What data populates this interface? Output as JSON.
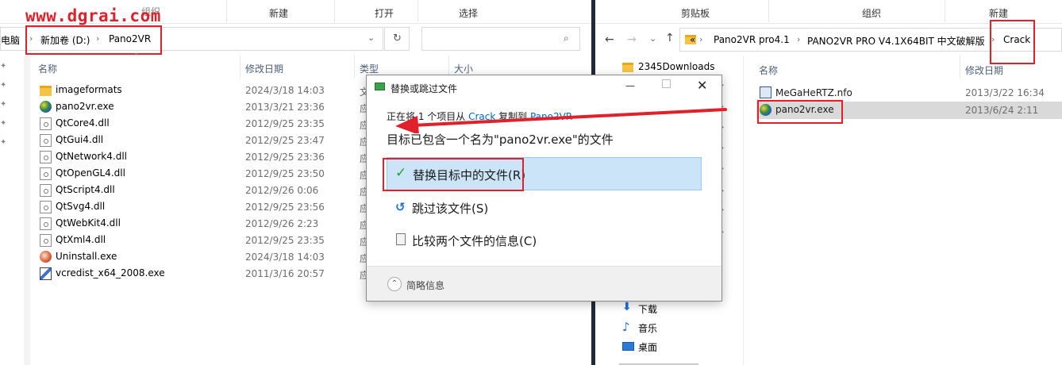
{
  "watermark": "www.dgrai.com",
  "left_window": {
    "ribbon": [
      "组织",
      "新建",
      "打开",
      "选择"
    ],
    "breadcrumb": {
      "truncated": "电脑",
      "drive": "新加卷 (D:)",
      "folder": "Pano2VR"
    },
    "columns": {
      "name": "名称",
      "date": "修改日期",
      "type": "类型",
      "size": "大小"
    },
    "files": [
      {
        "name": "imageformats",
        "date": "2024/3/18 14:03",
        "type": "文",
        "icon": "folder-icon"
      },
      {
        "name": "pano2vr.exe",
        "date": "2013/3/21 23:36",
        "type": "应",
        "icon": "pano2vr-app-icon"
      },
      {
        "name": "QtCore4.dll",
        "date": "2012/9/25 23:35",
        "type": "应",
        "icon": "dll-file-icon"
      },
      {
        "name": "QtGui4.dll",
        "date": "2012/9/25 23:47",
        "type": "应",
        "icon": "dll-file-icon"
      },
      {
        "name": "QtNetwork4.dll",
        "date": "2012/9/25 23:36",
        "type": "应",
        "icon": "dll-file-icon"
      },
      {
        "name": "QtOpenGL4.dll",
        "date": "2012/9/25 23:50",
        "type": "应",
        "icon": "dll-file-icon"
      },
      {
        "name": "QtScript4.dll",
        "date": "2012/9/26 0:06",
        "type": "应",
        "icon": "dll-file-icon"
      },
      {
        "name": "QtSvg4.dll",
        "date": "2012/9/25 23:56",
        "type": "应",
        "icon": "dll-file-icon"
      },
      {
        "name": "QtWebKit4.dll",
        "date": "2012/9/26 2:23",
        "type": "应",
        "icon": "dll-file-icon"
      },
      {
        "name": "QtXml4.dll",
        "date": "2012/9/25 23:35",
        "type": "应",
        "icon": "dll-file-icon"
      },
      {
        "name": "Uninstall.exe",
        "date": "2024/3/18 14:03",
        "type": "应",
        "icon": "uninstall-icon"
      },
      {
        "name": "vcredist_x64_2008.exe",
        "date": "2011/3/16 20:57",
        "type": "应",
        "icon": "installer-icon"
      }
    ]
  },
  "right_window": {
    "ribbon": [
      "剪贴板",
      "组织",
      "新建"
    ],
    "breadcrumb": {
      "overflow": "«",
      "items": [
        "Pano2VR pro4.1",
        "PANO2VR PRO V4.1X64BIT 中文破解版",
        "Crack"
      ]
    },
    "nav_items": [
      {
        "label": "2345Downloads",
        "icon": "folder-icon"
      },
      {
        "label": "下载",
        "icon": "download-icon"
      },
      {
        "label": "音乐",
        "icon": "music-icon"
      },
      {
        "label": "桌面",
        "icon": "desktop-icon"
      }
    ],
    "columns": {
      "name": "名称",
      "date": "修改日期"
    },
    "files": [
      {
        "name": "MeGaHeRTZ.nfo",
        "date": "2013/3/22 16:34",
        "icon": "nfo-file-icon"
      },
      {
        "name": "pano2vr.exe",
        "date": "2013/6/24 2:11",
        "icon": "pano2vr-app-icon"
      }
    ]
  },
  "dialog": {
    "title": "替换或跳过文件",
    "status_prefix": "正在将 1 个项目从 ",
    "source": "Crack",
    "status_mid": " 复制到 ",
    "destination": "Pano2VR",
    "heading": "目标已包含一个名为\"pano2vr.exe\"的文件",
    "options": {
      "replace": "替换目标中的文件(R)",
      "skip": "跳过该文件(S)",
      "compare": "比较两个文件的信息(C)"
    },
    "details": "简略信息",
    "accent": "#0067c0"
  },
  "annotation_color": "#e0202a"
}
